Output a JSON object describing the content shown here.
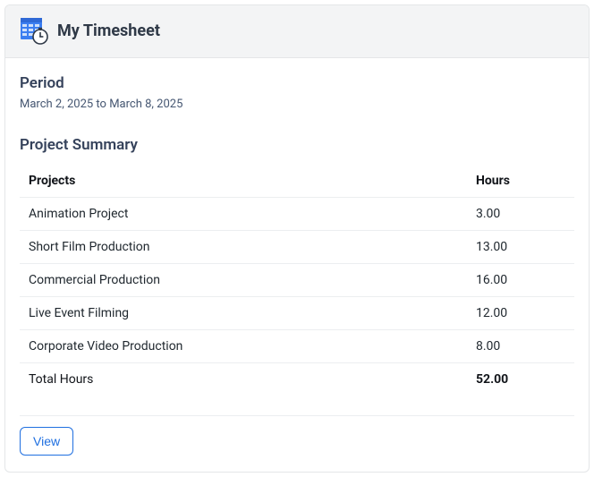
{
  "header": {
    "title": "My Timesheet"
  },
  "period": {
    "label": "Period",
    "text": "March 2, 2025 to March 8, 2025"
  },
  "summary": {
    "label": "Project Summary",
    "columns": {
      "project": "Projects",
      "hours": "Hours"
    },
    "rows": [
      {
        "project": "Animation Project",
        "hours": "3.00"
      },
      {
        "project": "Short Film Production",
        "hours": "13.00"
      },
      {
        "project": "Commercial Production",
        "hours": "16.00"
      },
      {
        "project": "Live Event Filming",
        "hours": "12.00"
      },
      {
        "project": "Corporate Video Production",
        "hours": "8.00"
      }
    ],
    "total": {
      "label": "Total Hours",
      "hours": "52.00"
    }
  },
  "actions": {
    "view_label": "View"
  },
  "colors": {
    "accent": "#1f6fe0",
    "calendar_blue": "#3b7ef1"
  }
}
